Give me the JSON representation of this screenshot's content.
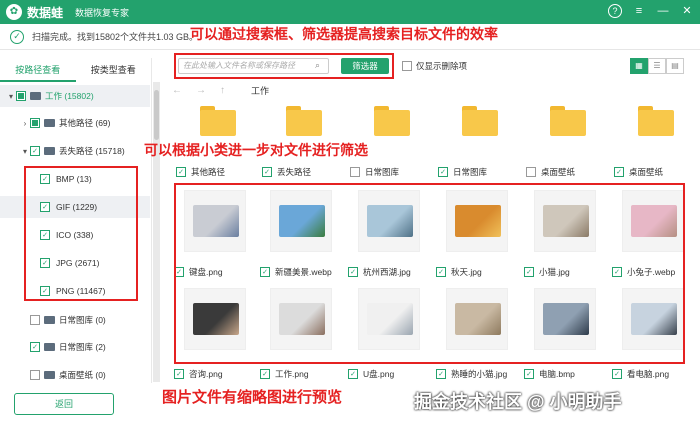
{
  "title": {
    "app_name": "数据蛙",
    "subtitle": "数据恢复专家"
  },
  "window_buttons": {
    "help": "?",
    "menu": "≡",
    "min": "—",
    "close": "✕"
  },
  "status": {
    "text": "扫描完成。找到15802个文件共1.03 GB。"
  },
  "annotations": {
    "search_tip": "可以通过搜索框、筛选器提高搜索目标文件的效率",
    "filter_tip": "可以根据小类进一步对文件进行筛选",
    "preview_tip": "图片文件有缩略图进行预览"
  },
  "sidebar": {
    "tabs": [
      "按路径查看",
      "按类型查看"
    ],
    "tree": [
      {
        "label": "工作 (15802)",
        "state": "part",
        "level": 0,
        "expander": "▾",
        "has_folder": true,
        "highlighted": true
      },
      {
        "label": "其他路径 (69)",
        "state": "part",
        "level": 1,
        "expander": "›",
        "has_folder": true
      },
      {
        "label": "丢失路径 (15718)",
        "state": "checked",
        "level": 1,
        "expander": "▾",
        "has_folder": true
      },
      {
        "label": "BMP (13)",
        "state": "checked",
        "level": 2
      },
      {
        "label": "GIF (1229)",
        "state": "checked",
        "level": 2,
        "highlighted": true
      },
      {
        "label": "ICO (338)",
        "state": "checked",
        "level": 2
      },
      {
        "label": "JPG (2671)",
        "state": "checked",
        "level": 2
      },
      {
        "label": "PNG (11467)",
        "state": "checked",
        "level": 2
      },
      {
        "label": "日常图库 (0)",
        "state": "none",
        "level": 1,
        "has_folder": true
      },
      {
        "label": "日常图库 (2)",
        "state": "checked",
        "level": 1,
        "has_folder": true
      },
      {
        "label": "桌面壁纸 (0)",
        "state": "none",
        "level": 1,
        "has_folder": true
      }
    ],
    "back_button": "返回"
  },
  "toolbar": {
    "search_placeholder": "在此处输入文件名称或保存路径",
    "filter_button": "筛选器",
    "deleted_only": "仅显示删除项"
  },
  "nav": {
    "back": "←",
    "forward": "→",
    "up": "↑",
    "path": "工作"
  },
  "folders": [
    {
      "label": "其他路径",
      "checked": true
    },
    {
      "label": "丢失路径",
      "checked": true
    },
    {
      "label": "日常图库",
      "checked": false
    },
    {
      "label": "日常图库",
      "checked": true
    },
    {
      "label": "桌面壁纸",
      "checked": false
    },
    {
      "label": "桌面壁纸",
      "checked": true
    }
  ],
  "images_row1": [
    {
      "label": "键盘.png",
      "color": "#c9ccd3",
      "accent": "#6a7fa0"
    },
    {
      "label": "新疆美景.webp",
      "color": "#6aa7d8",
      "accent": "#3a7c3e"
    },
    {
      "label": "杭州西湖.jpg",
      "color": "#a9c6d9",
      "accent": "#4f7187"
    },
    {
      "label": "秋天.jpg",
      "color": "#d98b2e",
      "accent": "#f0c15a"
    },
    {
      "label": "小猫.jpg",
      "color": "#cfc7bb",
      "accent": "#8a7a66"
    },
    {
      "label": "小兔子.webp",
      "color": "#e7b7c6",
      "accent": "#b58f82"
    }
  ],
  "images_row2": [
    {
      "label": "咨询.png",
      "color": "#3a3a3a",
      "accent": "#c9a78a"
    },
    {
      "label": "工作.png",
      "color": "#dcdcdc",
      "accent": "#8a6e5e"
    },
    {
      "label": "U盘.png",
      "color": "#f0f0f0",
      "accent": "#9aa5b0"
    },
    {
      "label": "熟睡的小猫.jpg",
      "color": "#c9b9a3",
      "accent": "#8e7a5e"
    },
    {
      "label": "电脑.bmp",
      "color": "#8fa0b2",
      "accent": "#2e3b4a"
    },
    {
      "label": "看电脑.png",
      "color": "#c7d3df",
      "accent": "#37404b"
    }
  ],
  "watermark": "掘金技术社区 @ 小明助手"
}
